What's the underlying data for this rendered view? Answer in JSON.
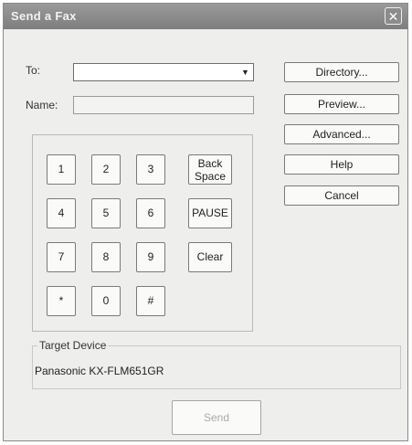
{
  "window": {
    "title": "Send a Fax",
    "close_label": "✕"
  },
  "to": {
    "label": "To:",
    "value": "",
    "arrow": "▼"
  },
  "name": {
    "label": "Name:",
    "value": ""
  },
  "buttons": {
    "directory": "Directory...",
    "preview": "Preview...",
    "advanced": "Advanced...",
    "help": "Help",
    "cancel": "Cancel"
  },
  "keypad": {
    "keys": [
      "1",
      "2",
      "3",
      "4",
      "5",
      "6",
      "7",
      "8",
      "9",
      "*",
      "0",
      "#"
    ],
    "backspace": "Back Space",
    "pause": "PAUSE",
    "clear": "Clear"
  },
  "target": {
    "legend": "Target Device",
    "device": "Panasonic KX-FLM651GR"
  },
  "send": {
    "label": "Send",
    "enabled": false
  }
}
